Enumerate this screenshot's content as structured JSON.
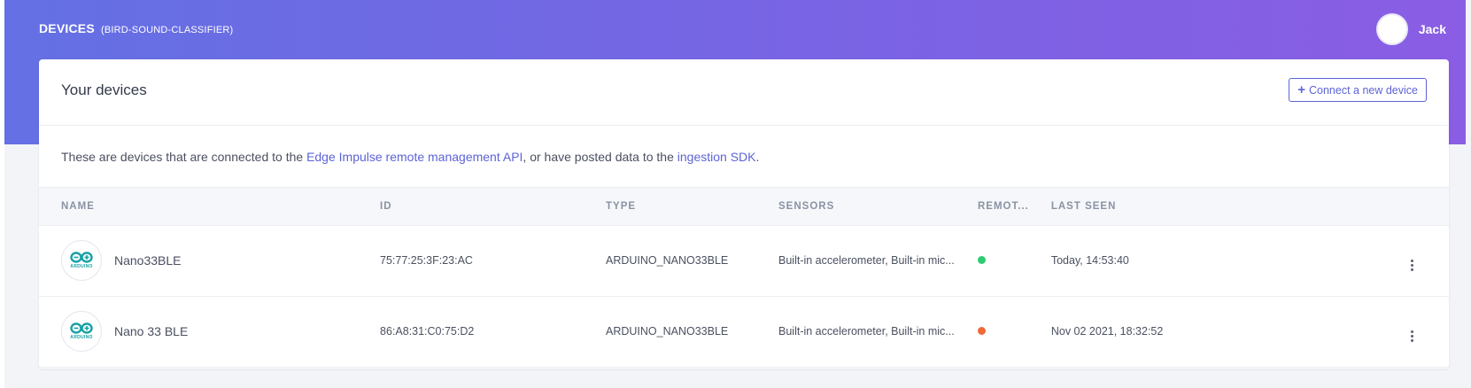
{
  "header": {
    "title": "DEVICES",
    "project": "(BIRD-SOUND-CLASSIFIER)",
    "user_name": "Jack"
  },
  "card": {
    "title": "Your devices",
    "connect_button": "Connect a new device",
    "intro_prefix": "These are devices that are connected to the ",
    "intro_link1": "Edge Impulse remote management API",
    "intro_middle": ", or have posted data to the ",
    "intro_link2": "ingestion SDK",
    "intro_suffix": "."
  },
  "table": {
    "columns": [
      "NAME",
      "ID",
      "TYPE",
      "SENSORS",
      "REMOT...",
      "LAST SEEN"
    ],
    "rows": [
      {
        "name": "Nano33BLE",
        "id": "75:77:25:3F:23:AC",
        "type": "ARDUINO_NANO33BLE",
        "sensors": "Built-in accelerometer, Built-in mic...",
        "remote_status": "#2ecc71",
        "last_seen": "Today, 14:53:40",
        "logo_text": "ARDUINO"
      },
      {
        "name": "Nano 33 BLE",
        "id": "86:A8:31:C0:75:D2",
        "type": "ARDUINO_NANO33BLE",
        "sensors": "Built-in accelerometer, Built-in mic...",
        "remote_status": "#f06a3a",
        "last_seen": "Nov 02 2021, 18:32:52",
        "logo_text": "ARDUINO"
      }
    ]
  },
  "colors": {
    "accent": "#5d63d8",
    "header_gradient_start": "#6470e4",
    "header_gradient_end": "#8a5de4"
  }
}
